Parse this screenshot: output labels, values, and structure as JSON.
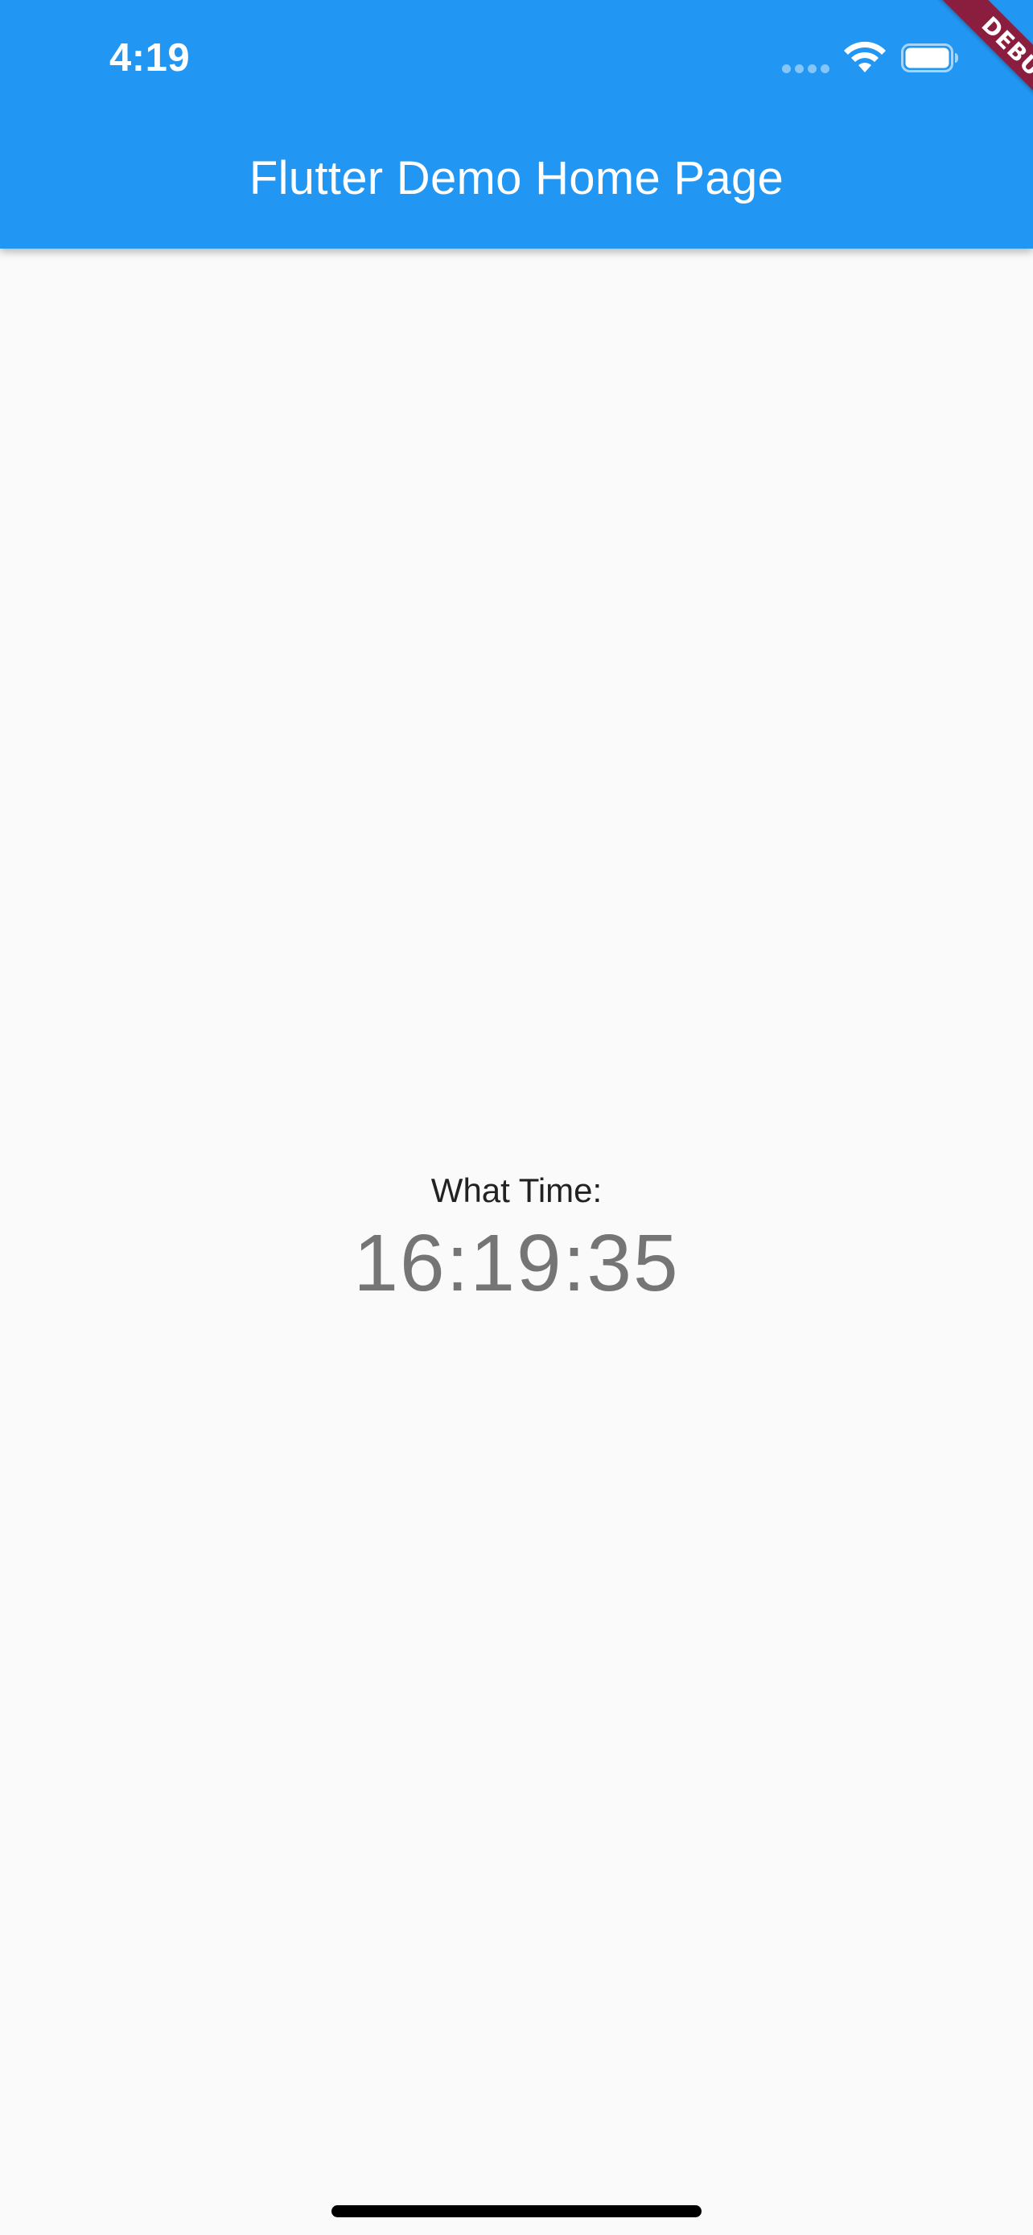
{
  "status_bar": {
    "time": "4:19",
    "icons": [
      "signal-dots-icon",
      "wifi-icon",
      "battery-icon"
    ]
  },
  "app_bar": {
    "title": "Flutter Demo Home Page",
    "background_color": "#2196f3"
  },
  "debug_banner": {
    "label": "DEBUG",
    "color": "#8b1e3f"
  },
  "body": {
    "label": "What Time:",
    "time_value": "16:19:35",
    "background_color": "#fafafa"
  }
}
